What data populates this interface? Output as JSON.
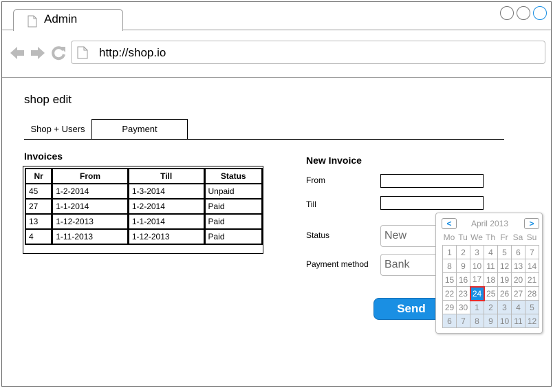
{
  "browser": {
    "tab_title": "Admin",
    "url": "http://shop.io"
  },
  "page": {
    "title": "shop edit",
    "tabs": [
      "Shop + Users",
      "Payment"
    ]
  },
  "invoices": {
    "title": "Invoices",
    "columns": [
      "Nr",
      "From",
      "Till",
      "Status"
    ],
    "rows": [
      [
        "45",
        "1-2-2014",
        "1-3-2014",
        "Unpaid"
      ],
      [
        "27",
        "1-1-2014",
        "1-2-2014",
        "Paid"
      ],
      [
        "13",
        "1-12-2013",
        "1-1-2014",
        "Paid"
      ],
      [
        "4",
        "1-11-2013",
        "1-12-2013",
        "Paid"
      ]
    ]
  },
  "new_invoice": {
    "title": "New Invoice",
    "from_label": "From",
    "till_label": "Till",
    "status_label": "Status",
    "status_value": "New",
    "payment_label": "Payment method",
    "payment_value": "Bank",
    "send_label": "Send"
  },
  "calendar": {
    "month": "April 2013",
    "prev_label": "<",
    "next_label": ">",
    "weekdays": [
      "Mo",
      "Tu",
      "We",
      "Th",
      "Fr",
      "Sa",
      "Su"
    ],
    "weeks": [
      [
        "1",
        "2",
        "3",
        "4",
        "5",
        "6",
        "7"
      ],
      [
        "8",
        "9",
        "10",
        "11",
        "12",
        "13",
        "14"
      ],
      [
        "15",
        "16",
        "17",
        "18",
        "19",
        "20",
        "21"
      ],
      [
        "22",
        "23",
        "24",
        "25",
        "26",
        "27",
        "28"
      ],
      [
        "29",
        "30",
        "1",
        "2",
        "3",
        "4",
        "5"
      ],
      [
        "6",
        "7",
        "8",
        "9",
        "10",
        "11",
        "12"
      ]
    ],
    "selected": "24"
  },
  "colors": {
    "accent": "#1a8fe3",
    "selected_border": "#e52b2b",
    "next_month_bg": "#dbe8f5"
  }
}
